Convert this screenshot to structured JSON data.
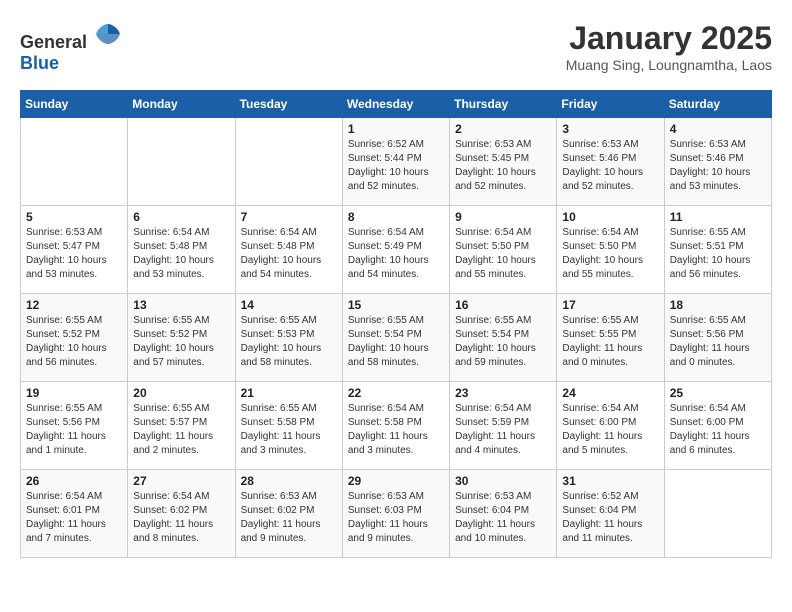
{
  "header": {
    "logo_general": "General",
    "logo_blue": "Blue",
    "title": "January 2025",
    "subtitle": "Muang Sing, Loungnamtha, Laos"
  },
  "days_of_week": [
    "Sunday",
    "Monday",
    "Tuesday",
    "Wednesday",
    "Thursday",
    "Friday",
    "Saturday"
  ],
  "weeks": [
    [
      {
        "day": "",
        "details": ""
      },
      {
        "day": "",
        "details": ""
      },
      {
        "day": "",
        "details": ""
      },
      {
        "day": "1",
        "details": "Sunrise: 6:52 AM\nSunset: 5:44 PM\nDaylight: 10 hours\nand 52 minutes."
      },
      {
        "day": "2",
        "details": "Sunrise: 6:53 AM\nSunset: 5:45 PM\nDaylight: 10 hours\nand 52 minutes."
      },
      {
        "day": "3",
        "details": "Sunrise: 6:53 AM\nSunset: 5:46 PM\nDaylight: 10 hours\nand 52 minutes."
      },
      {
        "day": "4",
        "details": "Sunrise: 6:53 AM\nSunset: 5:46 PM\nDaylight: 10 hours\nand 53 minutes."
      }
    ],
    [
      {
        "day": "5",
        "details": "Sunrise: 6:53 AM\nSunset: 5:47 PM\nDaylight: 10 hours\nand 53 minutes."
      },
      {
        "day": "6",
        "details": "Sunrise: 6:54 AM\nSunset: 5:48 PM\nDaylight: 10 hours\nand 53 minutes."
      },
      {
        "day": "7",
        "details": "Sunrise: 6:54 AM\nSunset: 5:48 PM\nDaylight: 10 hours\nand 54 minutes."
      },
      {
        "day": "8",
        "details": "Sunrise: 6:54 AM\nSunset: 5:49 PM\nDaylight: 10 hours\nand 54 minutes."
      },
      {
        "day": "9",
        "details": "Sunrise: 6:54 AM\nSunset: 5:50 PM\nDaylight: 10 hours\nand 55 minutes."
      },
      {
        "day": "10",
        "details": "Sunrise: 6:54 AM\nSunset: 5:50 PM\nDaylight: 10 hours\nand 55 minutes."
      },
      {
        "day": "11",
        "details": "Sunrise: 6:55 AM\nSunset: 5:51 PM\nDaylight: 10 hours\nand 56 minutes."
      }
    ],
    [
      {
        "day": "12",
        "details": "Sunrise: 6:55 AM\nSunset: 5:52 PM\nDaylight: 10 hours\nand 56 minutes."
      },
      {
        "day": "13",
        "details": "Sunrise: 6:55 AM\nSunset: 5:52 PM\nDaylight: 10 hours\nand 57 minutes."
      },
      {
        "day": "14",
        "details": "Sunrise: 6:55 AM\nSunset: 5:53 PM\nDaylight: 10 hours\nand 58 minutes."
      },
      {
        "day": "15",
        "details": "Sunrise: 6:55 AM\nSunset: 5:54 PM\nDaylight: 10 hours\nand 58 minutes."
      },
      {
        "day": "16",
        "details": "Sunrise: 6:55 AM\nSunset: 5:54 PM\nDaylight: 10 hours\nand 59 minutes."
      },
      {
        "day": "17",
        "details": "Sunrise: 6:55 AM\nSunset: 5:55 PM\nDaylight: 11 hours\nand 0 minutes."
      },
      {
        "day": "18",
        "details": "Sunrise: 6:55 AM\nSunset: 5:56 PM\nDaylight: 11 hours\nand 0 minutes."
      }
    ],
    [
      {
        "day": "19",
        "details": "Sunrise: 6:55 AM\nSunset: 5:56 PM\nDaylight: 11 hours\nand 1 minute."
      },
      {
        "day": "20",
        "details": "Sunrise: 6:55 AM\nSunset: 5:57 PM\nDaylight: 11 hours\nand 2 minutes."
      },
      {
        "day": "21",
        "details": "Sunrise: 6:55 AM\nSunset: 5:58 PM\nDaylight: 11 hours\nand 3 minutes."
      },
      {
        "day": "22",
        "details": "Sunrise: 6:54 AM\nSunset: 5:58 PM\nDaylight: 11 hours\nand 3 minutes."
      },
      {
        "day": "23",
        "details": "Sunrise: 6:54 AM\nSunset: 5:59 PM\nDaylight: 11 hours\nand 4 minutes."
      },
      {
        "day": "24",
        "details": "Sunrise: 6:54 AM\nSunset: 6:00 PM\nDaylight: 11 hours\nand 5 minutes."
      },
      {
        "day": "25",
        "details": "Sunrise: 6:54 AM\nSunset: 6:00 PM\nDaylight: 11 hours\nand 6 minutes."
      }
    ],
    [
      {
        "day": "26",
        "details": "Sunrise: 6:54 AM\nSunset: 6:01 PM\nDaylight: 11 hours\nand 7 minutes."
      },
      {
        "day": "27",
        "details": "Sunrise: 6:54 AM\nSunset: 6:02 PM\nDaylight: 11 hours\nand 8 minutes."
      },
      {
        "day": "28",
        "details": "Sunrise: 6:53 AM\nSunset: 6:02 PM\nDaylight: 11 hours\nand 9 minutes."
      },
      {
        "day": "29",
        "details": "Sunrise: 6:53 AM\nSunset: 6:03 PM\nDaylight: 11 hours\nand 9 minutes."
      },
      {
        "day": "30",
        "details": "Sunrise: 6:53 AM\nSunset: 6:04 PM\nDaylight: 11 hours\nand 10 minutes."
      },
      {
        "day": "31",
        "details": "Sunrise: 6:52 AM\nSunset: 6:04 PM\nDaylight: 11 hours\nand 11 minutes."
      },
      {
        "day": "",
        "details": ""
      }
    ]
  ]
}
